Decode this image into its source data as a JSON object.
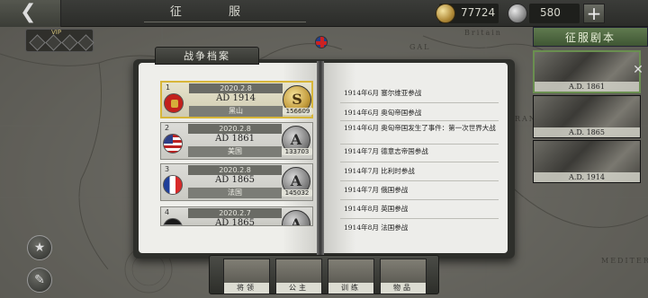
{
  "header": {
    "back_icon": "back-arrow-icon",
    "title": "征 服",
    "gold": "77724",
    "silver": "580",
    "plus_label": "+"
  },
  "map": {
    "labels": [
      "Britain",
      "GAL",
      "RAN",
      "MEDITER"
    ]
  },
  "vip": {
    "label": "VIP"
  },
  "book": {
    "title": "战争档案",
    "records": [
      {
        "no": "1",
        "date": "2020.2.8",
        "year": "AD 1914",
        "country": "黑山",
        "score": "156609",
        "medal": "S"
      },
      {
        "no": "2",
        "date": "2020.2.8",
        "year": "AD 1861",
        "country": "美国",
        "score": "133703",
        "medal": "A"
      },
      {
        "no": "3",
        "date": "2020.2.8",
        "year": "AD 1865",
        "country": "法国",
        "score": "145032",
        "medal": "A"
      },
      {
        "no": "4",
        "date": "2020.2.7",
        "year": "AD 1865",
        "country": "",
        "score": "",
        "medal": "A"
      }
    ],
    "events": [
      "1914年6月   塞尔维亚参战",
      "1914年6月   奥匈帝国参战",
      "1914年6月   奥匈帝国发生了事件：第一次世界大战",
      "1914年7月   德意志帝国参战",
      "1914年7月   比利时参战",
      "1914年7月   俄国参战",
      "1914年8月   英国参战",
      "1914年8月   法国参战"
    ]
  },
  "right_panel": {
    "conquer_label": "征服剧本",
    "scenarios": [
      "A.D. 1861",
      "A.D. 1865",
      "A.D. 1914"
    ]
  },
  "bottom_tabs": [
    "将领",
    "公主",
    "训练",
    "物品"
  ]
}
